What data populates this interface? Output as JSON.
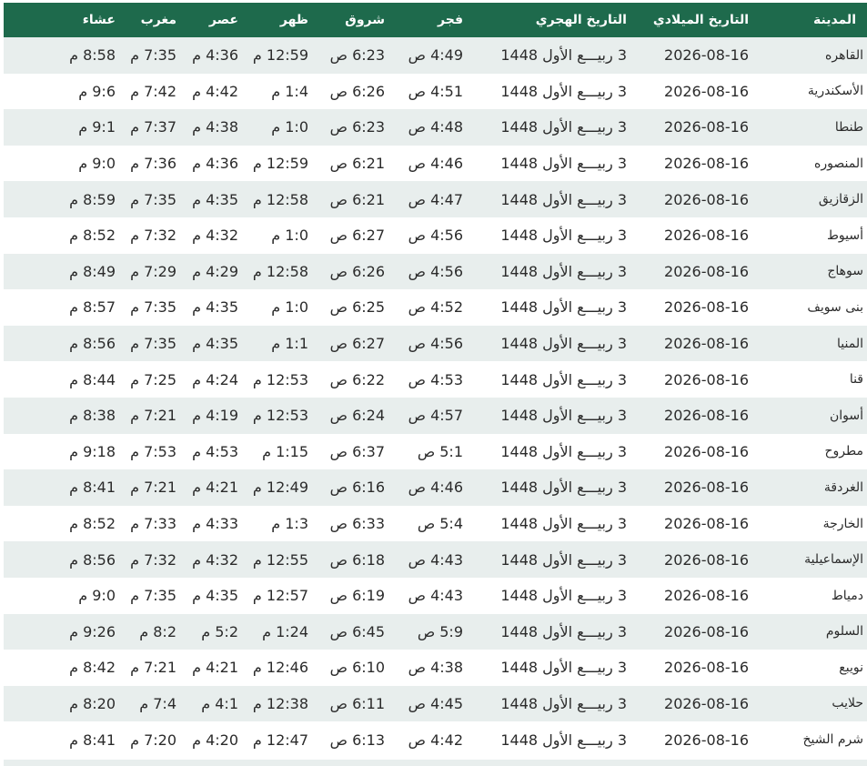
{
  "headers": [
    "المدينة",
    "التاريخ الميلادي",
    "التاريخ الهجري",
    "فجر",
    "شروق",
    "ظهر",
    "عصر",
    "مغرب",
    "عشاء"
  ],
  "rows": [
    {
      "city": "القاهره",
      "greg": "2026-08-16",
      "hijri": "3 ربيـــع الأول 1448",
      "fajr": "4:49 ص",
      "sunrise": "6:23 ص",
      "dhuhr": "12:59 م",
      "asr": "4:36 م",
      "maghrib": "7:35 م",
      "isha": "8:58 م"
    },
    {
      "city": "الأسكندرية",
      "greg": "2026-08-16",
      "hijri": "3 ربيـــع الأول 1448",
      "fajr": "4:51 ص",
      "sunrise": "6:26 ص",
      "dhuhr": "1:4 م",
      "asr": "4:42 م",
      "maghrib": "7:42 م",
      "isha": "9:6 م"
    },
    {
      "city": "طنطا",
      "greg": "2026-08-16",
      "hijri": "3 ربيـــع الأول 1448",
      "fajr": "4:48 ص",
      "sunrise": "6:23 ص",
      "dhuhr": "1:0 م",
      "asr": "4:38 م",
      "maghrib": "7:37 م",
      "isha": "9:1 م"
    },
    {
      "city": "المنصوره",
      "greg": "2026-08-16",
      "hijri": "3 ربيـــع الأول 1448",
      "fajr": "4:46 ص",
      "sunrise": "6:21 ص",
      "dhuhr": "12:59 م",
      "asr": "4:36 م",
      "maghrib": "7:36 م",
      "isha": "9:0 م"
    },
    {
      "city": "الزقازيق",
      "greg": "2026-08-16",
      "hijri": "3 ربيـــع الأول 1448",
      "fajr": "4:47 ص",
      "sunrise": "6:21 ص",
      "dhuhr": "12:58 م",
      "asr": "4:35 م",
      "maghrib": "7:35 م",
      "isha": "8:59 م"
    },
    {
      "city": "أسيوط",
      "greg": "2026-08-16",
      "hijri": "3 ربيـــع الأول 1448",
      "fajr": "4:56 ص",
      "sunrise": "6:27 ص",
      "dhuhr": "1:0 م",
      "asr": "4:32 م",
      "maghrib": "7:32 م",
      "isha": "8:52 م"
    },
    {
      "city": "سوهاج",
      "greg": "2026-08-16",
      "hijri": "3 ربيـــع الأول 1448",
      "fajr": "4:56 ص",
      "sunrise": "6:26 ص",
      "dhuhr": "12:58 م",
      "asr": "4:29 م",
      "maghrib": "7:29 م",
      "isha": "8:49 م"
    },
    {
      "city": "بنى سويف",
      "greg": "2026-08-16",
      "hijri": "3 ربيـــع الأول 1448",
      "fajr": "4:52 ص",
      "sunrise": "6:25 ص",
      "dhuhr": "1:0 م",
      "asr": "4:35 م",
      "maghrib": "7:35 م",
      "isha": "8:57 م"
    },
    {
      "city": "المنيا",
      "greg": "2026-08-16",
      "hijri": "3 ربيـــع الأول 1448",
      "fajr": "4:56 ص",
      "sunrise": "6:27 ص",
      "dhuhr": "1:1 م",
      "asr": "4:35 م",
      "maghrib": "7:35 م",
      "isha": "8:56 م"
    },
    {
      "city": "قنا",
      "greg": "2026-08-16",
      "hijri": "3 ربيـــع الأول 1448",
      "fajr": "4:53 ص",
      "sunrise": "6:22 ص",
      "dhuhr": "12:53 م",
      "asr": "4:24 م",
      "maghrib": "7:25 م",
      "isha": "8:44 م"
    },
    {
      "city": "أسوان",
      "greg": "2026-08-16",
      "hijri": "3 ربيـــع الأول 1448",
      "fajr": "4:57 ص",
      "sunrise": "6:24 ص",
      "dhuhr": "12:53 م",
      "asr": "4:19 م",
      "maghrib": "7:21 م",
      "isha": "8:38 م"
    },
    {
      "city": "مطروح",
      "greg": "2026-08-16",
      "hijri": "3 ربيـــع الأول 1448",
      "fajr": "5:1 ص",
      "sunrise": "6:37 ص",
      "dhuhr": "1:15 م",
      "asr": "4:53 م",
      "maghrib": "7:53 م",
      "isha": "9:18 م"
    },
    {
      "city": "الغردقة",
      "greg": "2026-08-16",
      "hijri": "3 ربيـــع الأول 1448",
      "fajr": "4:46 ص",
      "sunrise": "6:16 ص",
      "dhuhr": "12:49 م",
      "asr": "4:21 م",
      "maghrib": "7:21 م",
      "isha": "8:41 م"
    },
    {
      "city": "الخارجة",
      "greg": "2026-08-16",
      "hijri": "3 ربيـــع الأول 1448",
      "fajr": "5:4 ص",
      "sunrise": "6:33 ص",
      "dhuhr": "1:3 م",
      "asr": "4:33 م",
      "maghrib": "7:33 م",
      "isha": "8:52 م"
    },
    {
      "city": "الإسماعيلية",
      "greg": "2026-08-16",
      "hijri": "3 ربيـــع الأول 1448",
      "fajr": "4:43 ص",
      "sunrise": "6:18 ص",
      "dhuhr": "12:55 م",
      "asr": "4:32 م",
      "maghrib": "7:32 م",
      "isha": "8:56 م"
    },
    {
      "city": "دمياط",
      "greg": "2026-08-16",
      "hijri": "3 ربيـــع الأول 1448",
      "fajr": "4:43 ص",
      "sunrise": "6:19 ص",
      "dhuhr": "12:57 م",
      "asr": "4:35 م",
      "maghrib": "7:35 م",
      "isha": "9:0 م"
    },
    {
      "city": "السلوم",
      "greg": "2026-08-16",
      "hijri": "3 ربيـــع الأول 1448",
      "fajr": "5:9 ص",
      "sunrise": "6:45 ص",
      "dhuhr": "1:24 م",
      "asr": "5:2 م",
      "maghrib": "8:2 م",
      "isha": "9:26 م"
    },
    {
      "city": "نويبع",
      "greg": "2026-08-16",
      "hijri": "3 ربيـــع الأول 1448",
      "fajr": "4:38 ص",
      "sunrise": "6:10 ص",
      "dhuhr": "12:46 م",
      "asr": "4:21 م",
      "maghrib": "7:21 م",
      "isha": "8:42 م"
    },
    {
      "city": "حلايب",
      "greg": "2026-08-16",
      "hijri": "3 ربيـــع الأول 1448",
      "fajr": "4:45 ص",
      "sunrise": "6:11 ص",
      "dhuhr": "12:38 م",
      "asr": "4:1 م",
      "maghrib": "7:4 م",
      "isha": "8:20 م"
    },
    {
      "city": "شرم الشيخ",
      "greg": "2026-08-16",
      "hijri": "3 ربيـــع الأول 1448",
      "fajr": "4:42 ص",
      "sunrise": "6:13 ص",
      "dhuhr": "12:47 م",
      "asr": "4:20 م",
      "maghrib": "7:20 م",
      "isha": "8:41 م"
    }
  ],
  "colors": {
    "header_bg": "#1e6a4c",
    "header_text": "#ffffff",
    "row_alt_bg": "#e8eeed",
    "row_bg": "#ffffff",
    "text": "#2b2b2b"
  }
}
